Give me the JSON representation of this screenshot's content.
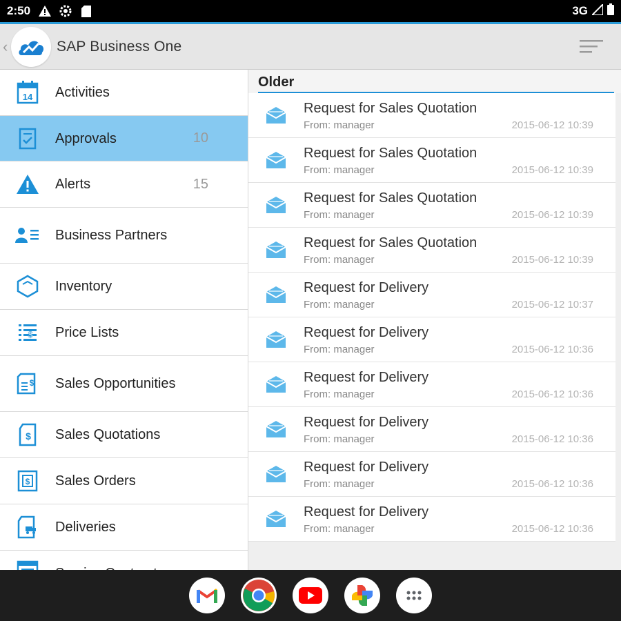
{
  "status_bar": {
    "time": "2:50",
    "network": "3G",
    "icons": [
      "warning-icon",
      "settings-icon",
      "sd-card-icon",
      "signal-icon",
      "battery-icon"
    ]
  },
  "app_bar": {
    "title": "SAP Business One",
    "icons": [
      "back-chevron-icon",
      "sap-logo-icon",
      "sort-menu-icon"
    ]
  },
  "sidebar": {
    "items": [
      {
        "label": "Activities",
        "icon": "calendar-icon",
        "count": ""
      },
      {
        "label": "Approvals",
        "icon": "approval-document-icon",
        "count": "10",
        "active": true
      },
      {
        "label": "Alerts",
        "icon": "alert-triangle-icon",
        "count": "15"
      },
      {
        "label": "Business Partners",
        "icon": "business-partners-icon",
        "count": ""
      },
      {
        "label": "Inventory",
        "icon": "inventory-box-icon",
        "count": ""
      },
      {
        "label": "Price Lists",
        "icon": "price-list-icon",
        "count": ""
      },
      {
        "label": "Sales Opportunities",
        "icon": "sales-opportunities-icon",
        "count": ""
      },
      {
        "label": "Sales Quotations",
        "icon": "sales-quotations-icon",
        "count": ""
      },
      {
        "label": "Sales Orders",
        "icon": "sales-orders-icon",
        "count": ""
      },
      {
        "label": "Deliveries",
        "icon": "deliveries-icon",
        "count": ""
      },
      {
        "label": "Service Contract",
        "icon": "service-contract-icon",
        "count": ""
      }
    ]
  },
  "main": {
    "section_title": "Older",
    "messages": [
      {
        "subject": "Request for Sales Quotation",
        "from": "From: manager",
        "date": "2015-06-12 10:39"
      },
      {
        "subject": "Request for Sales Quotation",
        "from": "From: manager",
        "date": "2015-06-12 10:39"
      },
      {
        "subject": "Request for Sales Quotation",
        "from": "From: manager",
        "date": "2015-06-12 10:39"
      },
      {
        "subject": "Request for Sales Quotation",
        "from": "From: manager",
        "date": "2015-06-12 10:39"
      },
      {
        "subject": "Request for Delivery",
        "from": "From: manager",
        "date": "2015-06-12 10:37"
      },
      {
        "subject": "Request for Delivery",
        "from": "From: manager",
        "date": "2015-06-12 10:36"
      },
      {
        "subject": "Request for Delivery",
        "from": "From: manager",
        "date": "2015-06-12 10:36"
      },
      {
        "subject": "Request for Delivery",
        "from": "From: manager",
        "date": "2015-06-12 10:36"
      },
      {
        "subject": "Request for Delivery",
        "from": "From: manager",
        "date": "2015-06-12 10:36"
      },
      {
        "subject": "Request for Delivery",
        "from": "From: manager",
        "date": "2015-06-12 10:36"
      }
    ]
  },
  "taskbar": {
    "apps": [
      "gmail-icon",
      "chrome-icon",
      "youtube-icon",
      "photos-icon",
      "app-drawer-icon"
    ]
  },
  "colors": {
    "accent": "#2a9bd8",
    "active_row": "#86c9f1",
    "icon_blue": "#1c8fd6"
  }
}
